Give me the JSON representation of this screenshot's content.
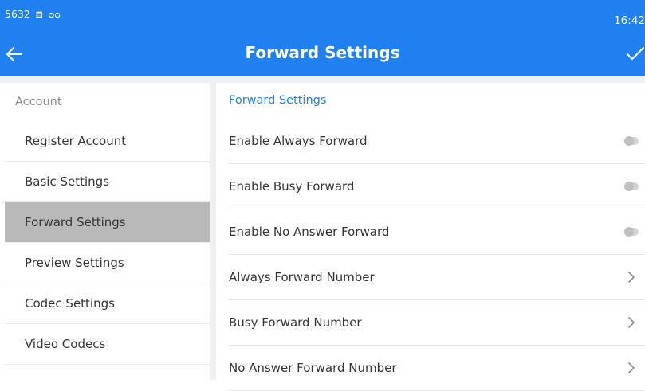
{
  "status_bar": {
    "left_text": "5632",
    "time": "16:42"
  },
  "app_bar": {
    "title": "Forward Settings"
  },
  "sidebar": {
    "header": "Account",
    "items": [
      {
        "label": "Register Account"
      },
      {
        "label": "Basic Settings"
      },
      {
        "label": "Forward Settings",
        "active": true
      },
      {
        "label": "Preview Settings"
      },
      {
        "label": "Codec Settings"
      },
      {
        "label": "Video Codecs"
      }
    ]
  },
  "content": {
    "section_title": "Forward Settings",
    "rows": [
      {
        "label": "Enable Always Forward",
        "control": "toggle",
        "state": "off"
      },
      {
        "label": "Enable Busy Forward",
        "control": "toggle",
        "state": "off"
      },
      {
        "label": "Enable No Answer Forward",
        "control": "toggle",
        "state": "off"
      },
      {
        "label": "Always Forward Number",
        "control": "chevron"
      },
      {
        "label": "Busy Forward Number",
        "control": "chevron"
      },
      {
        "label": "No Answer Forward Number",
        "control": "chevron"
      }
    ]
  },
  "colors": {
    "primary": "#2180f0",
    "active_item_bg": "#b9b9b9",
    "divider_bg": "#eef0f3"
  }
}
